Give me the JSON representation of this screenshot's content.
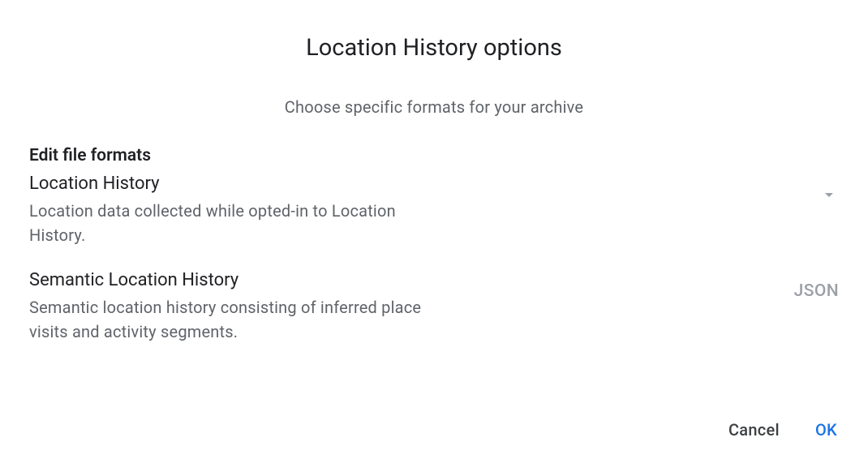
{
  "dialog": {
    "title": "Location History options",
    "subtitle": "Choose specific formats for your archive"
  },
  "section": {
    "header": "Edit file formats",
    "items": [
      {
        "title": "Location History",
        "description": "Location data collected while opted-in to Location History.",
        "value": ""
      },
      {
        "title": "Semantic Location History",
        "description": "Semantic location history consisting of inferred place visits and activity segments.",
        "value": "JSON"
      }
    ]
  },
  "actions": {
    "cancel": "Cancel",
    "ok": "OK"
  }
}
